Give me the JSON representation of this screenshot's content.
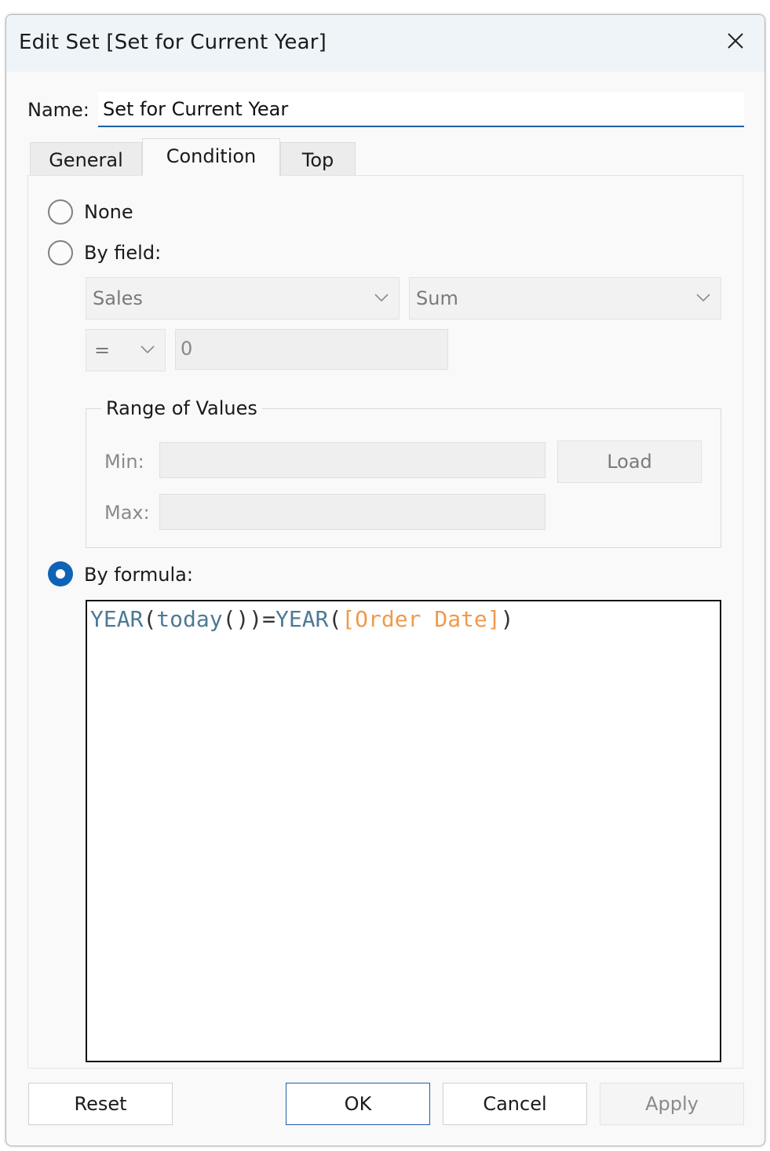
{
  "window": {
    "title": "Edit Set [Set for Current Year]"
  },
  "name": {
    "label": "Name:",
    "value": "Set for Current Year"
  },
  "tabs": [
    {
      "label": "General",
      "active": false
    },
    {
      "label": "Condition",
      "active": true
    },
    {
      "label": "Top",
      "active": false
    }
  ],
  "condition": {
    "none_label": "None",
    "by_field_label": "By field:",
    "field_value": "Sales",
    "aggregation_value": "Sum",
    "operator_value": "=",
    "value": "0",
    "range": {
      "label": "Range of Values",
      "min_label": "Min:",
      "max_label": "Max:",
      "min_value": "",
      "max_value": "",
      "load_label": "Load"
    },
    "by_formula_label": "By formula:",
    "selected": "by_formula",
    "formula": {
      "fn1": "YEAR",
      "p1": "(",
      "fn2": "today",
      "p2": "())=",
      "fn3": "YEAR",
      "p3": "(",
      "field": "[Order Date]",
      "p4": ")"
    }
  },
  "buttons": {
    "reset": "Reset",
    "ok": "OK",
    "cancel": "Cancel",
    "apply": "Apply"
  },
  "colors": {
    "accent": "#0f63b6",
    "function": "#4d7a95",
    "field": "#f09a4c"
  },
  "icons": {
    "close": "close-icon",
    "dropdown": "chevron-down-icon"
  }
}
